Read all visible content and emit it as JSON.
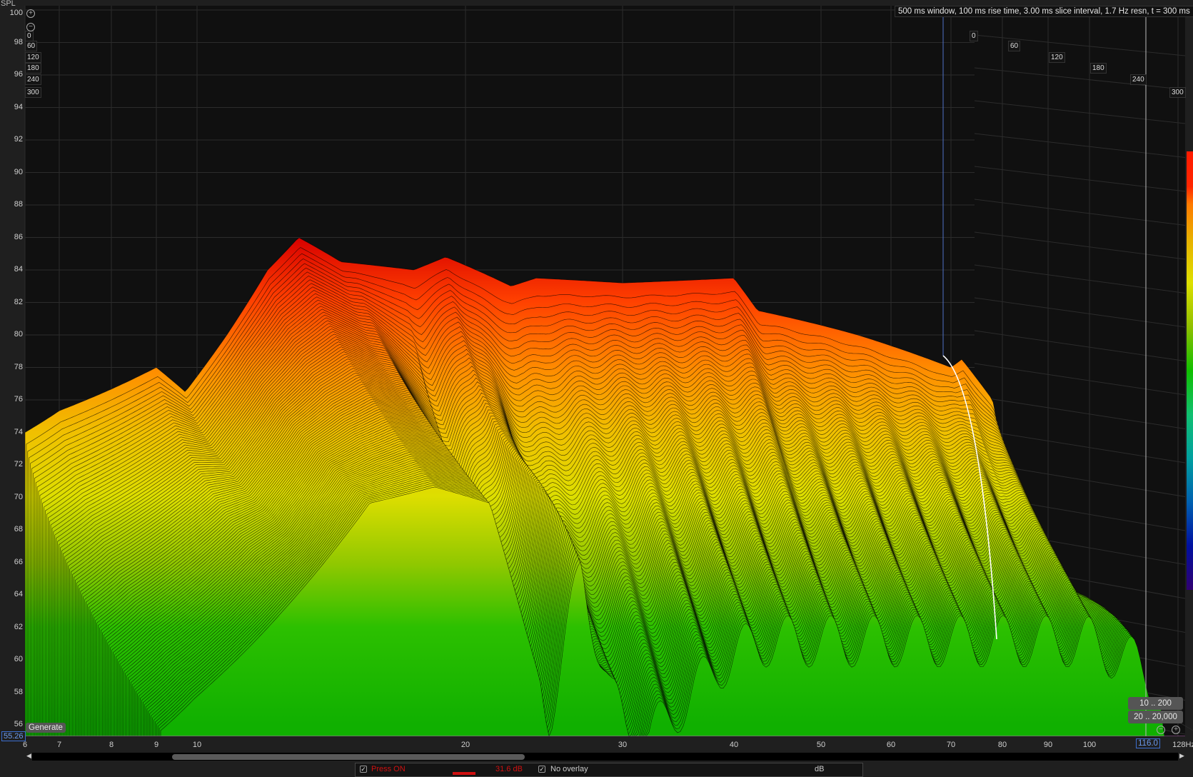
{
  "info_text": "500 ms window, 100 ms rise time, 3.00 ms slice interval, 1.7 Hz resn, t = 300 ms",
  "y_unit": "SPL",
  "y_min_value": "55.26",
  "x_cursor_value": "116.0",
  "generate_label": "Generate",
  "range_buttons": [
    "10 .. 200",
    "20 .. 20,000"
  ],
  "time_labels": [
    "0",
    "60",
    "120",
    "180",
    "240",
    "300"
  ],
  "bottom_panel": {
    "press_label": "Press ON",
    "level": "31.6 dB",
    "overlay_label": "No overlay",
    "unit": "dB"
  },
  "colors": {
    "press": "#d01010",
    "cursor_blue": "#4f72c8"
  },
  "chart_data": {
    "type": "waterfall",
    "title": "",
    "xlabel": "Hz",
    "ylabel": "SPL",
    "ylim": [
      55.26,
      100
    ],
    "xlim": [
      6,
      128
    ],
    "x_scale": "log",
    "x_ticks": [
      "6",
      "7",
      "8",
      "9",
      "10",
      "20",
      "30",
      "40",
      "50",
      "60",
      "70",
      "80",
      "90",
      "100",
      "128Hz"
    ],
    "y_ticks": [
      "100",
      "98",
      "96",
      "94",
      "92",
      "90",
      "88",
      "86",
      "84",
      "82",
      "80",
      "78",
      "76",
      "74",
      "72",
      "70",
      "68",
      "66",
      "64",
      "62",
      "60",
      "58",
      "56"
    ],
    "time_axis_ms": [
      0,
      300
    ],
    "slice_interval_ms": 3,
    "slice_t0": [
      [
        6,
        74
      ],
      [
        7.5,
        76
      ],
      [
        9,
        78
      ],
      [
        9.7,
        76.5
      ],
      [
        10.8,
        80
      ],
      [
        12,
        84
      ],
      [
        13,
        86
      ],
      [
        14.5,
        84.5
      ],
      [
        17.5,
        84
      ],
      [
        19,
        84.8
      ],
      [
        22.5,
        83
      ],
      [
        24,
        83.5
      ],
      [
        30,
        83.2
      ],
      [
        40,
        83.5
      ],
      [
        42.5,
        81.5
      ],
      [
        55,
        80
      ],
      [
        70,
        78
      ],
      [
        72,
        78.5
      ],
      [
        78,
        76
      ],
      [
        82,
        70
      ],
      [
        85,
        60
      ]
    ],
    "slice_t300": [
      [
        6,
        56
      ],
      [
        7,
        58
      ],
      [
        9,
        64
      ],
      [
        11,
        70
      ],
      [
        13,
        71
      ],
      [
        15,
        70
      ],
      [
        16.5,
        62
      ],
      [
        17.5,
        57
      ],
      [
        19,
        66
      ],
      [
        20.5,
        58
      ],
      [
        22,
        55
      ],
      [
        24,
        57
      ],
      [
        27,
        60
      ],
      [
        30,
        61.5
      ],
      [
        50,
        61.5
      ],
      [
        70,
        61.5
      ],
      [
        80,
        60
      ],
      [
        90,
        57
      ],
      [
        95,
        56
      ]
    ],
    "color_scale_db": [
      56,
      86
    ]
  }
}
